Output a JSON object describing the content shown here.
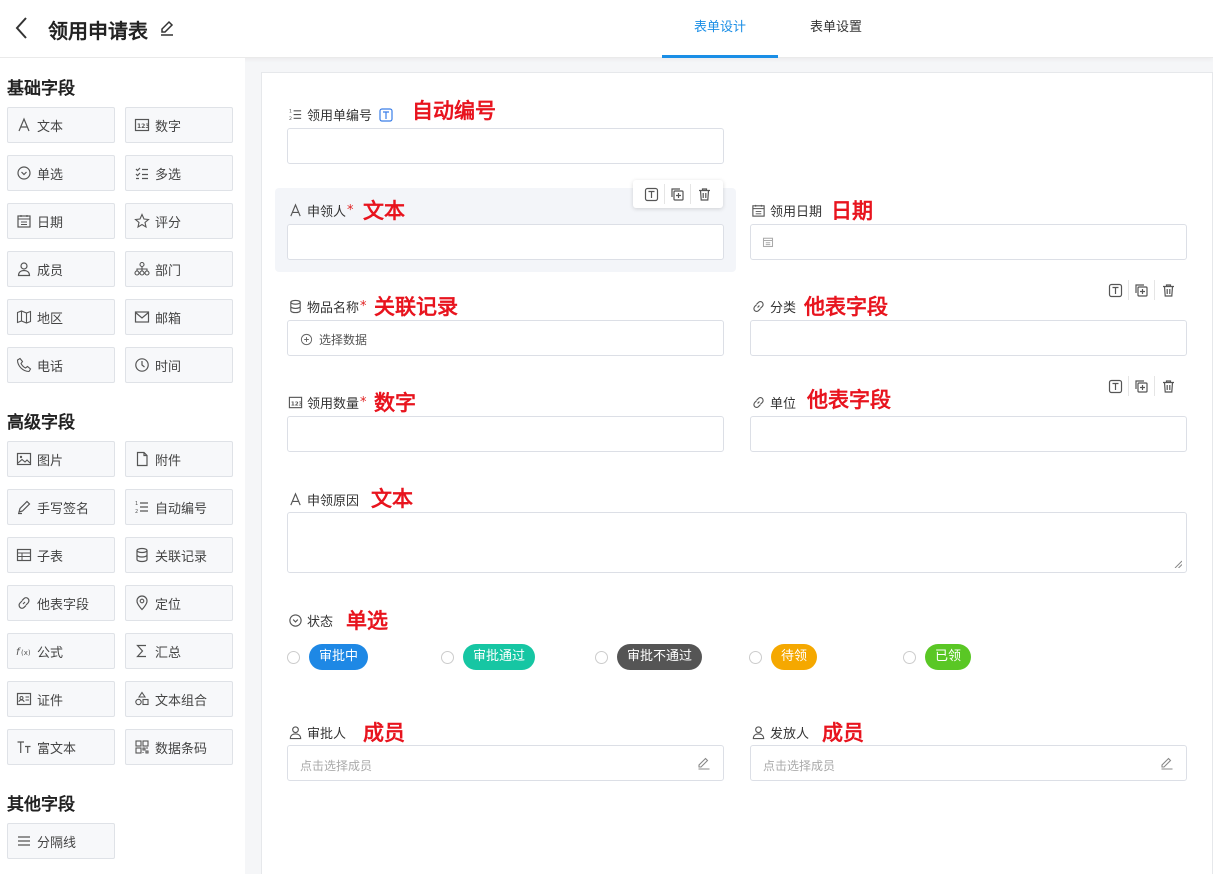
{
  "header": {
    "title": "领用申请表",
    "tabs": [
      {
        "label": "表单设计",
        "active": true
      },
      {
        "label": "表单设置",
        "active": false
      }
    ]
  },
  "sidebar": {
    "basic_title": "基础字段",
    "basic": [
      {
        "label": "文本",
        "icon": "text-icon"
      },
      {
        "label": "数字",
        "icon": "number-icon"
      },
      {
        "label": "单选",
        "icon": "radio-icon"
      },
      {
        "label": "多选",
        "icon": "checklist-icon"
      },
      {
        "label": "日期",
        "icon": "calendar-icon"
      },
      {
        "label": "评分",
        "icon": "star-icon"
      },
      {
        "label": "成员",
        "icon": "user-icon"
      },
      {
        "label": "部门",
        "icon": "org-icon"
      },
      {
        "label": "地区",
        "icon": "map-icon"
      },
      {
        "label": "邮箱",
        "icon": "mail-icon"
      },
      {
        "label": "电话",
        "icon": "phone-icon"
      },
      {
        "label": "时间",
        "icon": "clock-icon"
      }
    ],
    "advanced_title": "高级字段",
    "advanced": [
      {
        "label": "图片",
        "icon": "image-icon"
      },
      {
        "label": "附件",
        "icon": "file-icon"
      },
      {
        "label": "手写签名",
        "icon": "pen-icon"
      },
      {
        "label": "自动编号",
        "icon": "numbered-list-icon"
      },
      {
        "label": "子表",
        "icon": "table-icon"
      },
      {
        "label": "关联记录",
        "icon": "database-icon"
      },
      {
        "label": "他表字段",
        "icon": "link-icon"
      },
      {
        "label": "定位",
        "icon": "location-icon"
      },
      {
        "label": "公式",
        "icon": "formula-icon"
      },
      {
        "label": "汇总",
        "icon": "sigma-icon"
      },
      {
        "label": "证件",
        "icon": "id-card-icon"
      },
      {
        "label": "文本组合",
        "icon": "shapes-icon"
      },
      {
        "label": "富文本",
        "icon": "rich-text-icon"
      },
      {
        "label": "数据条码",
        "icon": "qrcode-icon"
      }
    ],
    "other_title": "其他字段",
    "other": [
      {
        "label": "分隔线",
        "icon": "divider-icon"
      }
    ]
  },
  "form": {
    "f1": {
      "label": "领用单编号",
      "anno": "自动编号"
    },
    "f2": {
      "label": "申领人",
      "required": "*",
      "anno": "文本"
    },
    "f3": {
      "label": "领用日期",
      "anno": "日期"
    },
    "f4": {
      "label": "物品名称",
      "required": "*",
      "anno": "关联记录",
      "button": "选择数据"
    },
    "f5": {
      "label": "分类",
      "anno": "他表字段"
    },
    "f6": {
      "label": "领用数量",
      "required": "*",
      "anno": "数字"
    },
    "f7": {
      "label": "单位",
      "anno": "他表字段"
    },
    "f8": {
      "label": "申领原因",
      "anno": "文本"
    },
    "f9": {
      "label": "状态",
      "anno": "单选",
      "options": [
        {
          "label": "审批中",
          "color": "#1e88e5"
        },
        {
          "label": "审批通过",
          "color": "#16c6a3"
        },
        {
          "label": "审批不通过",
          "color": "#555555"
        },
        {
          "label": "待领",
          "color": "#f5a800"
        },
        {
          "label": "已领",
          "color": "#5ac725"
        }
      ]
    },
    "f10": {
      "label": "审批人",
      "anno": "成员",
      "placeholder": "点击选择成员"
    },
    "f11": {
      "label": "发放人",
      "anno": "成员",
      "placeholder": "点击选择成员"
    }
  }
}
